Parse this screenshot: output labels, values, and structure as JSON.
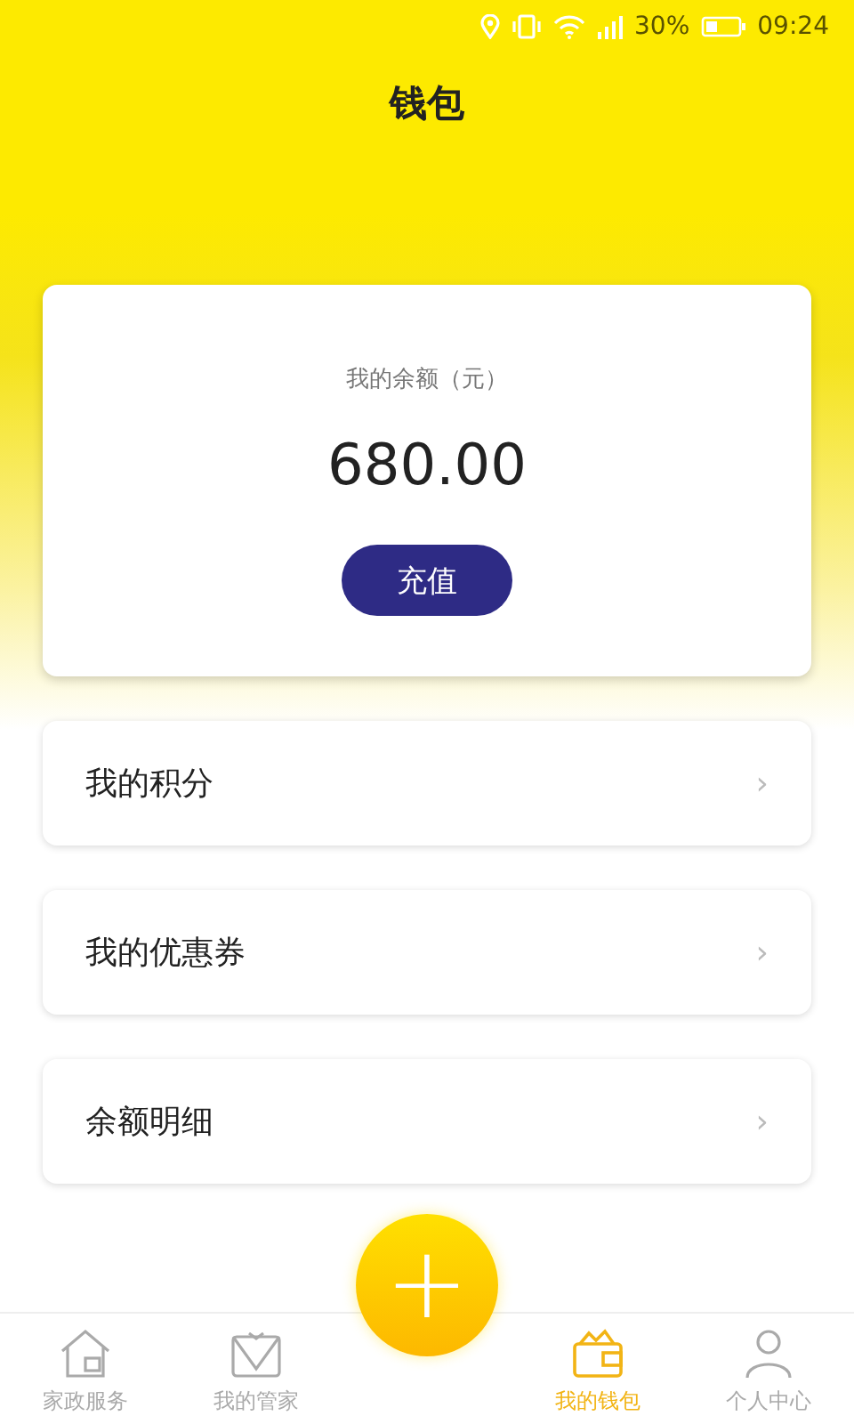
{
  "status_bar": {
    "battery": "30%",
    "time": "09:24"
  },
  "header": {
    "title": "钱包"
  },
  "balance_card": {
    "label": "我的余额（元）",
    "amount": "680.00",
    "button": "充值"
  },
  "menu_items": [
    {
      "label": "我的积分",
      "chevron": "›"
    },
    {
      "label": "我的优惠券",
      "chevron": "›"
    },
    {
      "label": "余额明细",
      "chevron": "›"
    }
  ],
  "add_button": {
    "symbol": "+"
  },
  "bottom_nav": [
    {
      "label": "家政服务",
      "selected": false
    },
    {
      "label": "我的管家",
      "selected": false
    },
    {
      "label": "我的钱包",
      "selected": true
    },
    {
      "label": "个人中心",
      "selected": false
    }
  ]
}
